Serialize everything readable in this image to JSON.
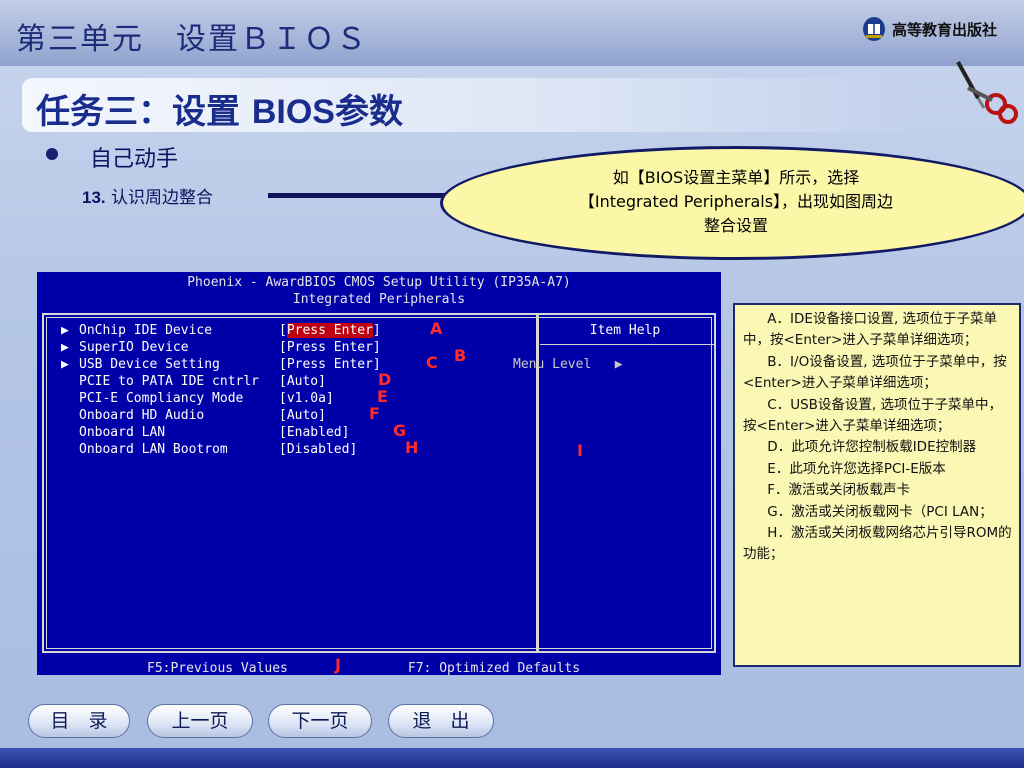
{
  "header": {
    "title": "第三单元　设置ＢＩＯＳ",
    "publisher": "高等教育出版社"
  },
  "task": {
    "title_prefix": "任务三：设置 ",
    "title_latin": "BIOS",
    "title_suffix": "参数"
  },
  "bullet": {
    "text": "自己动手",
    "step_num": "13.",
    "step_text": " 认识周边整合"
  },
  "callout": {
    "line1": "如【BIOS设置主菜单】所示，选择",
    "line2": "【Integrated Peripherals】，出现如图周边",
    "line3": "整合设置"
  },
  "bios": {
    "header_line1": "Phoenix - AwardBIOS CMOS Setup Utility (IP35A-A7)",
    "header_line2": "Integrated Peripherals",
    "rows": [
      {
        "arrow": "▶",
        "label": "OnChip IDE Device",
        "value": "Press Enter",
        "marker": "A"
      },
      {
        "arrow": "▶",
        "label": "SuperIO Device",
        "value": "Press Enter",
        "marker": "B"
      },
      {
        "arrow": "▶",
        "label": "USB Device Setting",
        "value": "Press Enter",
        "marker": "C"
      },
      {
        "arrow": "",
        "label": "PCIE to PATA IDE cntrlr",
        "value": "Auto",
        "marker": "D"
      },
      {
        "arrow": "",
        "label": "PCI-E Compliancy Mode",
        "value": "v1.0a",
        "marker": "E"
      },
      {
        "arrow": "",
        "label": "Onboard HD Audio",
        "value": "Auto",
        "marker": "F"
      },
      {
        "arrow": "",
        "label": "Onboard LAN",
        "value": "Enabled",
        "marker": "G"
      },
      {
        "arrow": "",
        "label": "Onboard LAN Bootrom",
        "value": "Disabled",
        "marker": "H"
      }
    ],
    "item_help": "Item Help",
    "menu_level": "Menu Level   ▶",
    "help_marker": "I",
    "footer_left": "F5:Previous Values",
    "footer_right": "F7: Optimized Defaults",
    "footer_marker": "J"
  },
  "notes": [
    "A．IDE设备接口设置, 选项位于子菜单中，按<Enter>进入子菜单详细选项；",
    "B．I/O设备设置, 选项位于子菜单中，按<Enter>进入子菜单详细选项；",
    "C．USB设备设置, 选项位于子菜单中，按<Enter>进入子菜单详细选项；",
    "D．此项允许您控制板载IDE控制器",
    "E．此项允许您选择PCI-E版本",
    "F．激活或关闭板载声卡",
    "G．激活或关闭板载网卡（PCI LAN；",
    "H．激活或关闭板载网络芯片引导ROM的功能；"
  ],
  "nav": {
    "toc": "目　录",
    "prev": "上一页",
    "next": "下一页",
    "exit": "退　出"
  },
  "colors": {
    "bios_bg": "#0000a8",
    "highlight": "#c00010",
    "marker": "#ff2a2a",
    "callout_bg": "#fbf7a6"
  }
}
